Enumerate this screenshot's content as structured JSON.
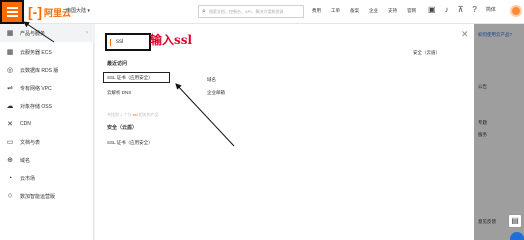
{
  "topbar": {
    "logo_text": "阿里云",
    "region": "中国大陆 ▾",
    "search_placeholder": "搜索文档、控制台、API、解决方案和资源",
    "links": [
      "费用",
      "工单",
      "备案",
      "企业",
      "支持",
      "官网"
    ],
    "icons": [
      "terminal-icon",
      "bell-icon",
      "cart-icon",
      "help-icon"
    ],
    "lang": "简体"
  },
  "sidebar": {
    "header": "产品与服务",
    "items": [
      {
        "icon": "server-icon",
        "glyph": "▦",
        "label": "云服务器 ECS"
      },
      {
        "icon": "database-icon",
        "glyph": "◎",
        "label": "云数据库 RDS 版"
      },
      {
        "icon": "vpc-icon",
        "glyph": "⇌",
        "label": "专有网络 VPC"
      },
      {
        "icon": "storage-icon",
        "glyph": "☁",
        "label": "对象存储 OSS"
      },
      {
        "icon": "cdn-icon",
        "glyph": "✕",
        "label": "CDN"
      },
      {
        "icon": "file-icon",
        "glyph": "▭",
        "label": "文档与表"
      },
      {
        "icon": "domain-icon",
        "glyph": "⊕",
        "label": "域名"
      },
      {
        "icon": "market-icon",
        "glyph": "◔",
        "label": "云市场"
      },
      {
        "icon": "code-icon",
        "glyph": "⟨⟩",
        "label": "数加智能运营版"
      }
    ]
  },
  "panel": {
    "search_value": "ssl",
    "annotation": "输入ssl",
    "recent_title": "最近访问",
    "recent": [
      {
        "label": "SSL 证书（应用安全）",
        "col": 0
      },
      {
        "label": "云解析 DNS",
        "col": 0
      },
      {
        "label": "域名",
        "col": 1
      },
      {
        "label": "企业邮箱",
        "col": 1
      }
    ],
    "found_prefix": "共找到 1 个与 ",
    "found_keyword": "ssl",
    "found_suffix": " 相关的产品",
    "category": "安全（云盾）",
    "result": "SSL 证书（应用安全）",
    "side_card": "安全（云盾）"
  },
  "right": {
    "line1": "如何使用云产品?",
    "line2": "公告",
    "line3": "专题",
    "line4": "服务",
    "line5": "意见反馈"
  }
}
